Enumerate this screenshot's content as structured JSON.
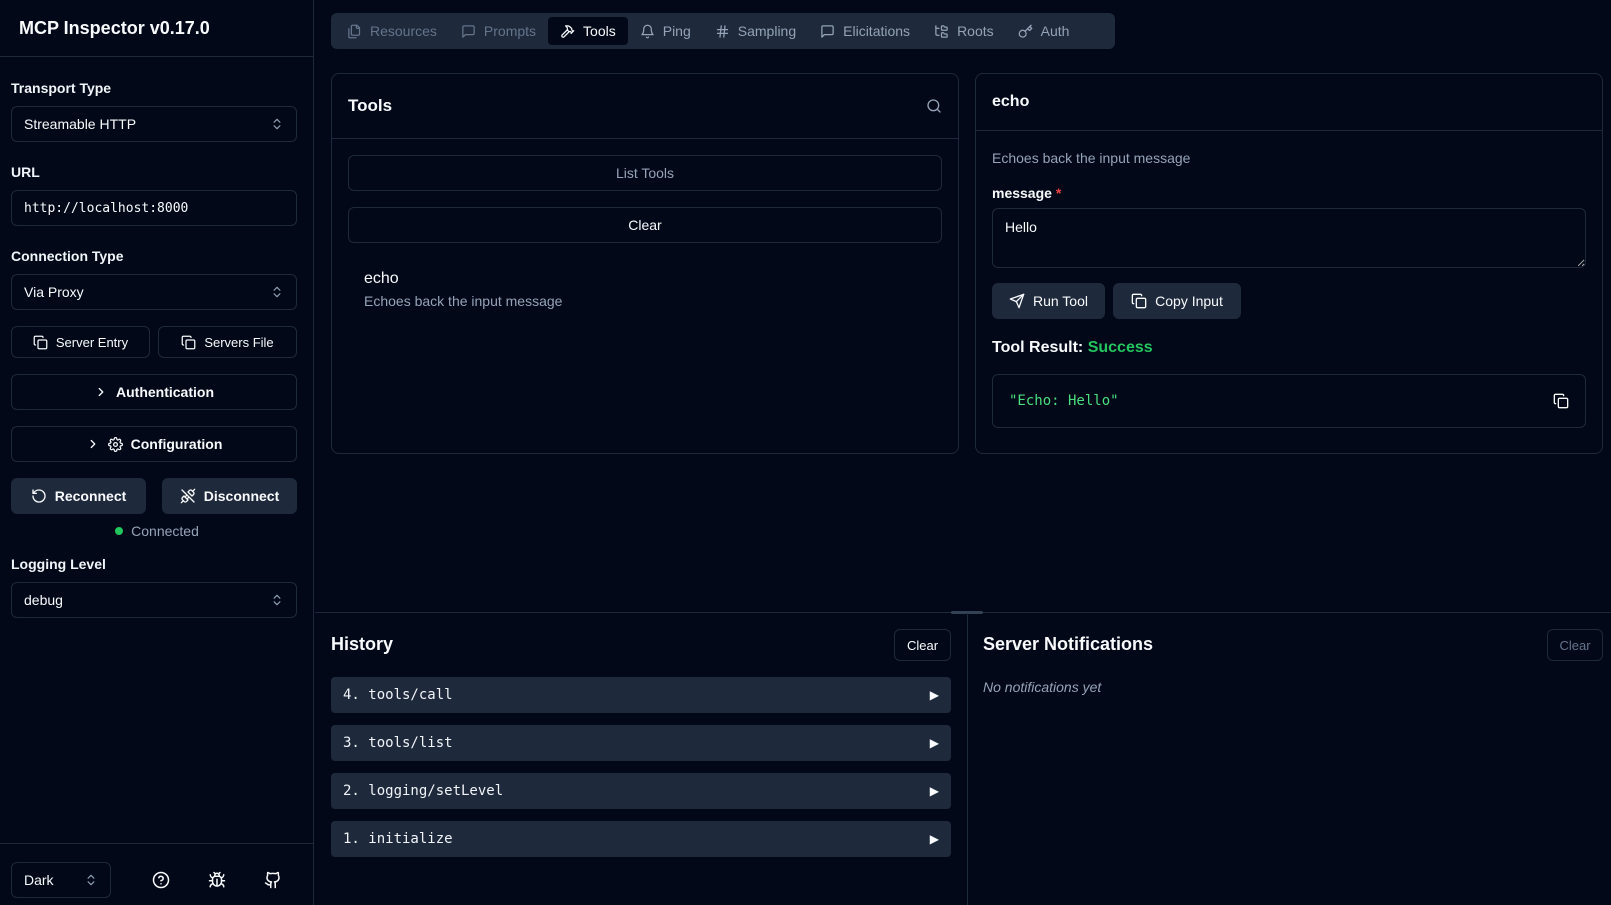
{
  "app": {
    "title": "MCP Inspector v0.17.0"
  },
  "sidebar": {
    "transport_label": "Transport Type",
    "transport_value": "Streamable HTTP",
    "url_label": "URL",
    "url_value": "http://localhost:8000",
    "connection_label": "Connection Type",
    "connection_value": "Via Proxy",
    "server_entry_label": "Server Entry",
    "servers_file_label": "Servers File",
    "authentication_label": "Authentication",
    "configuration_label": "Configuration",
    "reconnect_label": "Reconnect",
    "disconnect_label": "Disconnect",
    "status_text": "Connected",
    "logging_label": "Logging Level",
    "logging_value": "debug",
    "theme_value": "Dark"
  },
  "tabs": [
    {
      "label": "Resources",
      "icon": "files-icon"
    },
    {
      "label": "Prompts",
      "icon": "message-icon"
    },
    {
      "label": "Tools",
      "icon": "hammer-icon"
    },
    {
      "label": "Ping",
      "icon": "bell-icon"
    },
    {
      "label": "Sampling",
      "icon": "hash-icon"
    },
    {
      "label": "Elicitations",
      "icon": "message-square-icon"
    },
    {
      "label": "Roots",
      "icon": "folder-tree-icon"
    },
    {
      "label": "Auth",
      "icon": "key-icon"
    }
  ],
  "tools_panel": {
    "title": "Tools",
    "list_tools_label": "List Tools",
    "clear_label": "Clear",
    "items": [
      {
        "name": "echo",
        "description": "Echoes back the input message"
      }
    ]
  },
  "tool_detail": {
    "name": "echo",
    "description": "Echoes back the input message",
    "param_label": "message",
    "required_mark": "*",
    "param_value": "Hello",
    "run_label": "Run Tool",
    "copy_label": "Copy Input",
    "result_label": "Tool Result:",
    "result_status": "Success",
    "result_output": "\"Echo: Hello\""
  },
  "history": {
    "title": "History",
    "clear_label": "Clear",
    "items": [
      {
        "label": "4. tools/call"
      },
      {
        "label": "3. tools/list"
      },
      {
        "label": "2. logging/setLevel"
      },
      {
        "label": "1. initialize"
      }
    ]
  },
  "notifications": {
    "title": "Server Notifications",
    "clear_label": "Clear",
    "empty_text": "No notifications yet"
  },
  "colors": {
    "background": "#020817",
    "border": "#1e293b",
    "success": "#22c55e",
    "muted": "#94a3b8"
  }
}
